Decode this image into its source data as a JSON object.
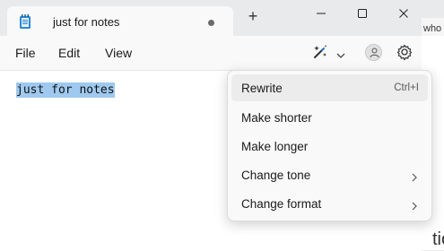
{
  "window": {
    "tab_title": "just for notes",
    "new_tab_symbol": "+"
  },
  "behind_window": {
    "top_text": "who",
    "lower_text": "tion"
  },
  "menubar": {
    "file": "File",
    "edit": "Edit",
    "view": "View"
  },
  "editor": {
    "text": "just for notes"
  },
  "rewrite_menu": {
    "items": [
      {
        "label": "Rewrite",
        "shortcut": "Ctrl+I",
        "submenu": false
      },
      {
        "label": "Make shorter",
        "submenu": false
      },
      {
        "label": "Make longer",
        "submenu": false
      },
      {
        "label": "Change tone",
        "submenu": true
      },
      {
        "label": "Change format",
        "submenu": true
      }
    ]
  },
  "icons": {
    "app": "notepad-icon",
    "copilot": "copilot-rewrite-icon",
    "account": "account-icon",
    "settings": "gear-icon"
  },
  "colors": {
    "selection": "#9fc9ef",
    "menu_hover": "#ececec",
    "accent": "#1a73c7"
  }
}
